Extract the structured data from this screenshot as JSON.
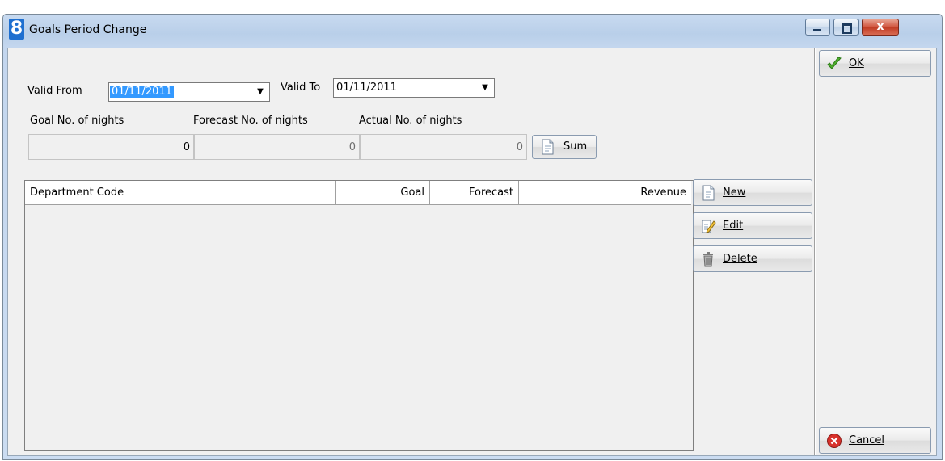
{
  "window": {
    "app_icon": "8",
    "title": "Goals Period Change",
    "controls": {
      "close_glyph": "x"
    }
  },
  "valid_from": {
    "label": "Valid From",
    "value": "01/11/2011"
  },
  "valid_to": {
    "label": "Valid To",
    "value": "01/11/2011"
  },
  "dropdown_arrow": "▼",
  "nights": {
    "goal": {
      "label": "Goal No. of nights",
      "value": "0"
    },
    "forecast": {
      "label": "Forecast No. of nights",
      "value": "0"
    },
    "actual": {
      "label": "Actual No. of nights",
      "value": "0"
    }
  },
  "sum_button": {
    "label": "Sum",
    "icon": "document-icon"
  },
  "table": {
    "columns": [
      "Department Code",
      "Goal",
      "Forecast",
      "Revenue"
    ],
    "rows": []
  },
  "actions": {
    "new": {
      "label": "New",
      "icon": "document-icon"
    },
    "edit": {
      "label": "Edit",
      "icon": "edit-pencil-icon"
    },
    "delete": {
      "label": "Delete",
      "icon": "trash-icon"
    }
  },
  "ok_button": {
    "label": "OK",
    "icon": "checkmark-icon"
  },
  "cancel_button": {
    "label": "Cancel",
    "icon": "cancel-icon"
  },
  "colors": {
    "selection": "#3399ff",
    "titlebar": "#c3d6ee",
    "close": "#c03b22"
  }
}
